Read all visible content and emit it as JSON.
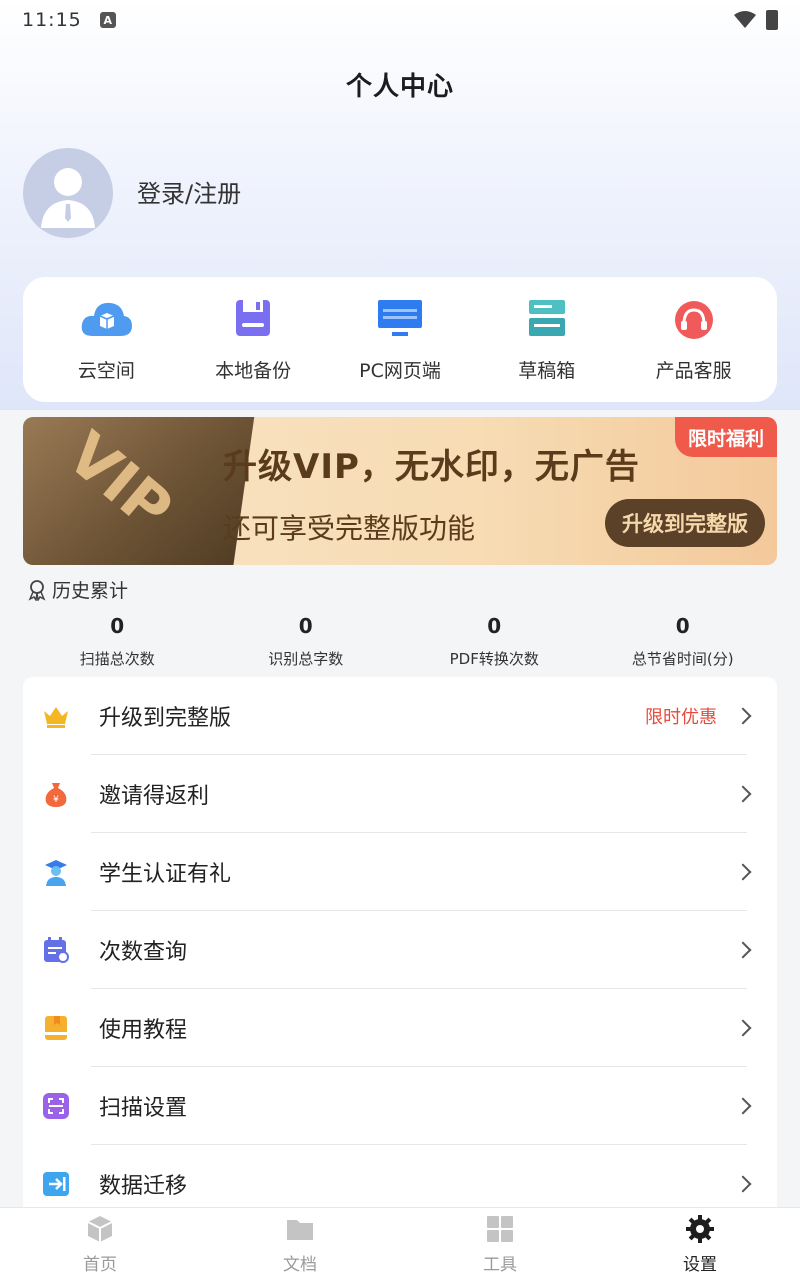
{
  "status_bar": {
    "time": "11:15",
    "notification_icon": "A"
  },
  "page_title": "个人中心",
  "user": {
    "login_label": "登录/注册"
  },
  "quick_actions": [
    {
      "label": "云空间",
      "icon": "cloud-icon"
    },
    {
      "label": "本地备份",
      "icon": "save-icon"
    },
    {
      "label": "PC网页端",
      "icon": "monitor-icon"
    },
    {
      "label": "草稿箱",
      "icon": "drafts-box-icon"
    },
    {
      "label": "产品客服",
      "icon": "headset-icon"
    }
  ],
  "vip_banner": {
    "title": "升级VIP，无水印，无广告",
    "subtitle": "还可享受完整版功能",
    "tag": "限时福利",
    "button": "升级到完整版",
    "card_text": "VIP"
  },
  "history": {
    "label": "历史累计",
    "stats": [
      {
        "value": "0",
        "label": "扫描总次数"
      },
      {
        "value": "0",
        "label": "识别总字数"
      },
      {
        "value": "0",
        "label": "PDF转换次数"
      },
      {
        "value": "0",
        "label": "总节省时间(分)"
      }
    ]
  },
  "menu": [
    {
      "label": "升级到完整版",
      "tag": "限时优惠",
      "icon": "crown-icon"
    },
    {
      "label": "邀请得返利",
      "tag": "",
      "icon": "money-bag-icon"
    },
    {
      "label": "学生认证有礼",
      "tag": "",
      "icon": "student-icon"
    },
    {
      "label": "次数查询",
      "tag": "",
      "icon": "calendar-search-icon"
    },
    {
      "label": "使用教程",
      "tag": "",
      "icon": "book-icon"
    },
    {
      "label": "扫描设置",
      "tag": "",
      "icon": "scan-icon"
    },
    {
      "label": "数据迁移",
      "tag": "",
      "icon": "migrate-icon"
    }
  ],
  "bottom_nav": [
    {
      "label": "首页",
      "icon": "cube-icon"
    },
    {
      "label": "文档",
      "icon": "folder-icon"
    },
    {
      "label": "工具",
      "icon": "grid-icon"
    },
    {
      "label": "设置",
      "icon": "gear-icon"
    }
  ],
  "colors": {
    "accent_red": "#e64b3c",
    "vip_brown": "#5b4128",
    "vip_gold": "#f7dcb4",
    "nav_inactive": "#9a9a9a"
  }
}
